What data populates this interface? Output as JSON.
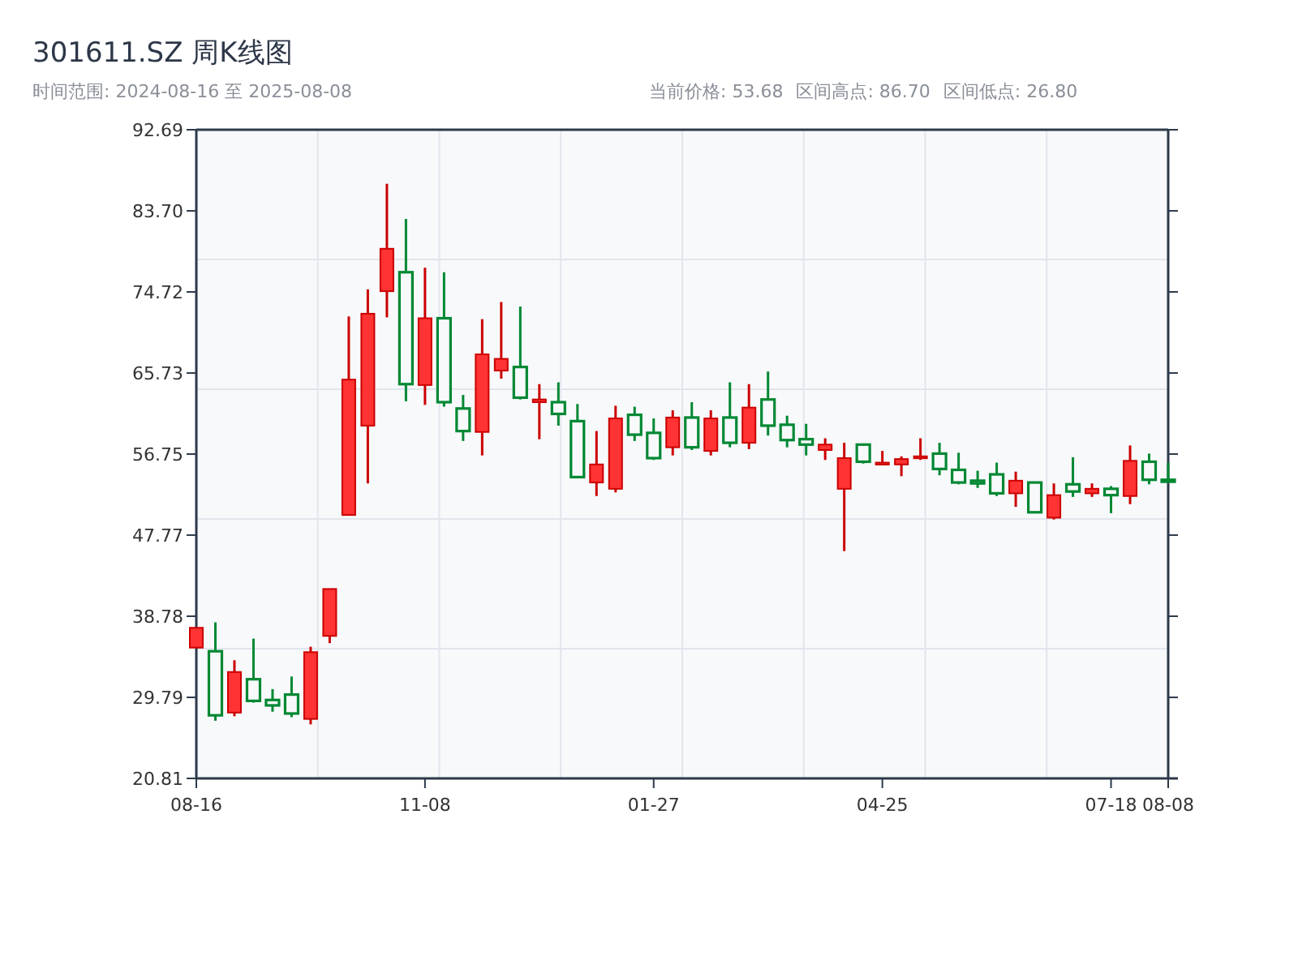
{
  "header": {
    "title": "301611.SZ 周K线图",
    "range": "时间范围: 2024-08-16 至 2025-08-08",
    "stats": [
      "当前价格: 53.68",
      "区间高点: 86.70",
      "区间低点: 26.80"
    ]
  },
  "chart": {
    "chart_data": {
      "type": "candlestick",
      "grid": true,
      "ylim": [
        20.81,
        92.69
      ],
      "yticks": [
        {
          "value": 92.69,
          "label": "92.69"
        },
        {
          "value": 83.7,
          "label": "83.70"
        },
        {
          "value": 74.72,
          "label": "74.72"
        },
        {
          "value": 65.73,
          "label": "65.73"
        },
        {
          "value": 56.75,
          "label": "56.75"
        },
        {
          "value": 47.77,
          "label": "47.77"
        },
        {
          "value": 38.78,
          "label": "38.78"
        },
        {
          "value": 29.79,
          "label": "29.79"
        },
        {
          "value": 20.81,
          "label": "20.81"
        }
      ],
      "categories": [
        "08-16",
        null,
        null,
        null,
        null,
        null,
        null,
        null,
        null,
        null,
        null,
        null,
        "11-08",
        null,
        null,
        null,
        null,
        null,
        null,
        null,
        null,
        null,
        null,
        null,
        "01-27",
        null,
        null,
        null,
        null,
        null,
        null,
        null,
        null,
        null,
        null,
        null,
        "04-25",
        null,
        null,
        null,
        null,
        null,
        null,
        null,
        null,
        null,
        null,
        null,
        "07-18",
        null,
        null,
        "08-08"
      ],
      "ohlc": [
        [
          35.3,
          37.5,
          35.3,
          37.5
        ],
        [
          34.9,
          38.1,
          27.2,
          27.8
        ],
        [
          28.1,
          33.9,
          27.7,
          32.6
        ],
        [
          31.8,
          36.3,
          29.2,
          29.4
        ],
        [
          29.5,
          30.7,
          28.2,
          28.9
        ],
        [
          30.1,
          32.1,
          27.6,
          28.0
        ],
        [
          27.4,
          35.4,
          26.8,
          34.8
        ],
        [
          36.6,
          41.8,
          35.8,
          41.8
        ],
        [
          50.0,
          72.0,
          50.0,
          65.0
        ],
        [
          59.9,
          75.0,
          53.5,
          72.3
        ],
        [
          74.8,
          86.7,
          71.9,
          79.5
        ],
        [
          76.9,
          82.8,
          62.6,
          64.5
        ],
        [
          64.4,
          77.4,
          62.2,
          71.8
        ],
        [
          71.8,
          76.9,
          62.0,
          62.5
        ],
        [
          61.8,
          63.3,
          58.2,
          59.3
        ],
        [
          59.2,
          71.7,
          56.6,
          67.8
        ],
        [
          66.0,
          73.6,
          65.1,
          67.3
        ],
        [
          66.4,
          73.1,
          62.8,
          63.0
        ],
        [
          62.5,
          64.5,
          58.4,
          62.8
        ],
        [
          62.5,
          64.7,
          59.9,
          61.2
        ],
        [
          60.4,
          62.3,
          54.2,
          54.2
        ],
        [
          53.6,
          59.3,
          52.1,
          55.6
        ],
        [
          52.9,
          62.1,
          52.5,
          60.7
        ],
        [
          61.1,
          62.0,
          58.2,
          58.9
        ],
        [
          59.1,
          60.7,
          56.1,
          56.3
        ],
        [
          57.5,
          61.6,
          56.6,
          60.8
        ],
        [
          60.8,
          62.5,
          57.2,
          57.5
        ],
        [
          57.1,
          61.6,
          56.6,
          60.7
        ],
        [
          60.8,
          64.7,
          57.5,
          58.0
        ],
        [
          58.0,
          64.5,
          57.3,
          61.9
        ],
        [
          62.8,
          65.9,
          58.8,
          59.9
        ],
        [
          60.0,
          61.0,
          57.5,
          58.3
        ],
        [
          58.4,
          60.1,
          56.6,
          57.8
        ],
        [
          57.2,
          58.5,
          56.1,
          57.8
        ],
        [
          52.9,
          58.0,
          46.0,
          56.3
        ],
        [
          57.8,
          57.8,
          55.7,
          55.9
        ],
        [
          55.6,
          57.1,
          55.6,
          55.8
        ],
        [
          55.6,
          56.5,
          54.3,
          56.2
        ],
        [
          56.3,
          58.5,
          56.1,
          56.5
        ],
        [
          56.8,
          58.0,
          54.4,
          55.1
        ],
        [
          55.0,
          56.9,
          53.4,
          53.6
        ],
        [
          53.8,
          54.9,
          53.0,
          53.5
        ],
        [
          54.5,
          55.8,
          52.1,
          52.4
        ],
        [
          52.4,
          54.8,
          50.9,
          53.8
        ],
        [
          53.6,
          53.6,
          50.3,
          50.3
        ],
        [
          49.7,
          53.5,
          49.5,
          52.2
        ],
        [
          53.4,
          56.4,
          52.0,
          52.6
        ],
        [
          52.4,
          53.5,
          52.0,
          52.9
        ],
        [
          52.9,
          53.2,
          50.2,
          52.2
        ],
        [
          52.1,
          57.7,
          51.2,
          56.0
        ],
        [
          55.9,
          56.8,
          53.4,
          53.9
        ],
        [
          53.9,
          55.8,
          53.7,
          53.7
        ]
      ]
    }
  }
}
